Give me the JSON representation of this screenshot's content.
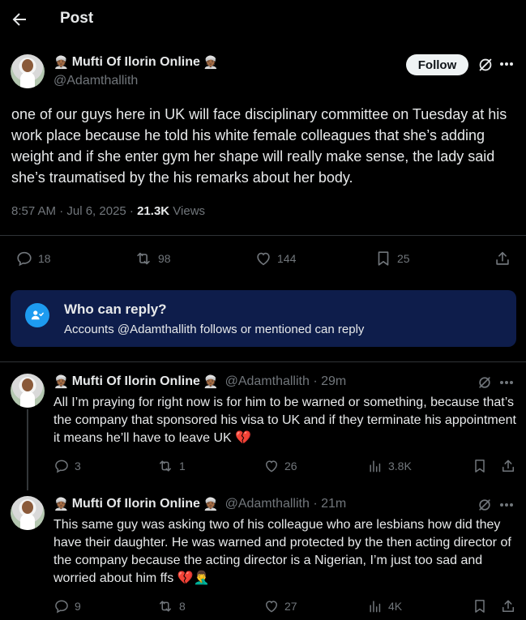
{
  "header": {
    "title": "Post"
  },
  "post": {
    "author_name": "Mufti Of Ilorin Online",
    "author_emoji": "👳🏾",
    "handle": "@Adamthallith",
    "follow_label": "Follow",
    "text": "one of our guys here in UK will face disciplinary committee on Tuesday at his work place because he told his white female colleagues that she’s adding weight and if she enter gym her shape will really make sense, the lady said she’s traumatised by the  his remarks about her body.",
    "time": "8:57 AM · Jul 6, 2025 ·",
    "views_count": "21.3K",
    "views_label": "Views",
    "replies": "18",
    "reposts": "98",
    "likes": "144",
    "bookmarks": "25"
  },
  "who_can_reply": {
    "title": "Who can reply?",
    "subtitle": "Accounts @Adamthallith follows or mentioned can reply"
  },
  "replies": [
    {
      "author_name": "Mufti Of Ilorin Online",
      "author_emoji": "👳🏾",
      "handle_time": "@Adamthallith · 29m",
      "text": "All I’m praying for right now is for him to be warned or something, because that’s the company that sponsored his visa to UK and if they terminate his appointment it means he’ll have to leave UK 💔",
      "replies": "3",
      "reposts": "1",
      "likes": "26",
      "views": "3.8K"
    },
    {
      "author_name": "Mufti Of Ilorin Online",
      "author_emoji": "👳🏾",
      "handle_time": "@Adamthallith · 21m",
      "text": "This same guy was asking two of his colleague who are lesbians how did they have their daughter. He was warned and protected by the then acting director of the company because the acting director is a Nigerian, I’m just too sad and worried about him ffs 💔🤦‍♂️",
      "replies": "9",
      "reposts": "8",
      "likes": "27",
      "views": "4K"
    }
  ],
  "colors": {
    "accent": "#1d9bf0",
    "muted": "#71767b",
    "text": "#e7e9ea",
    "reply_box": "#0e1d4b"
  }
}
